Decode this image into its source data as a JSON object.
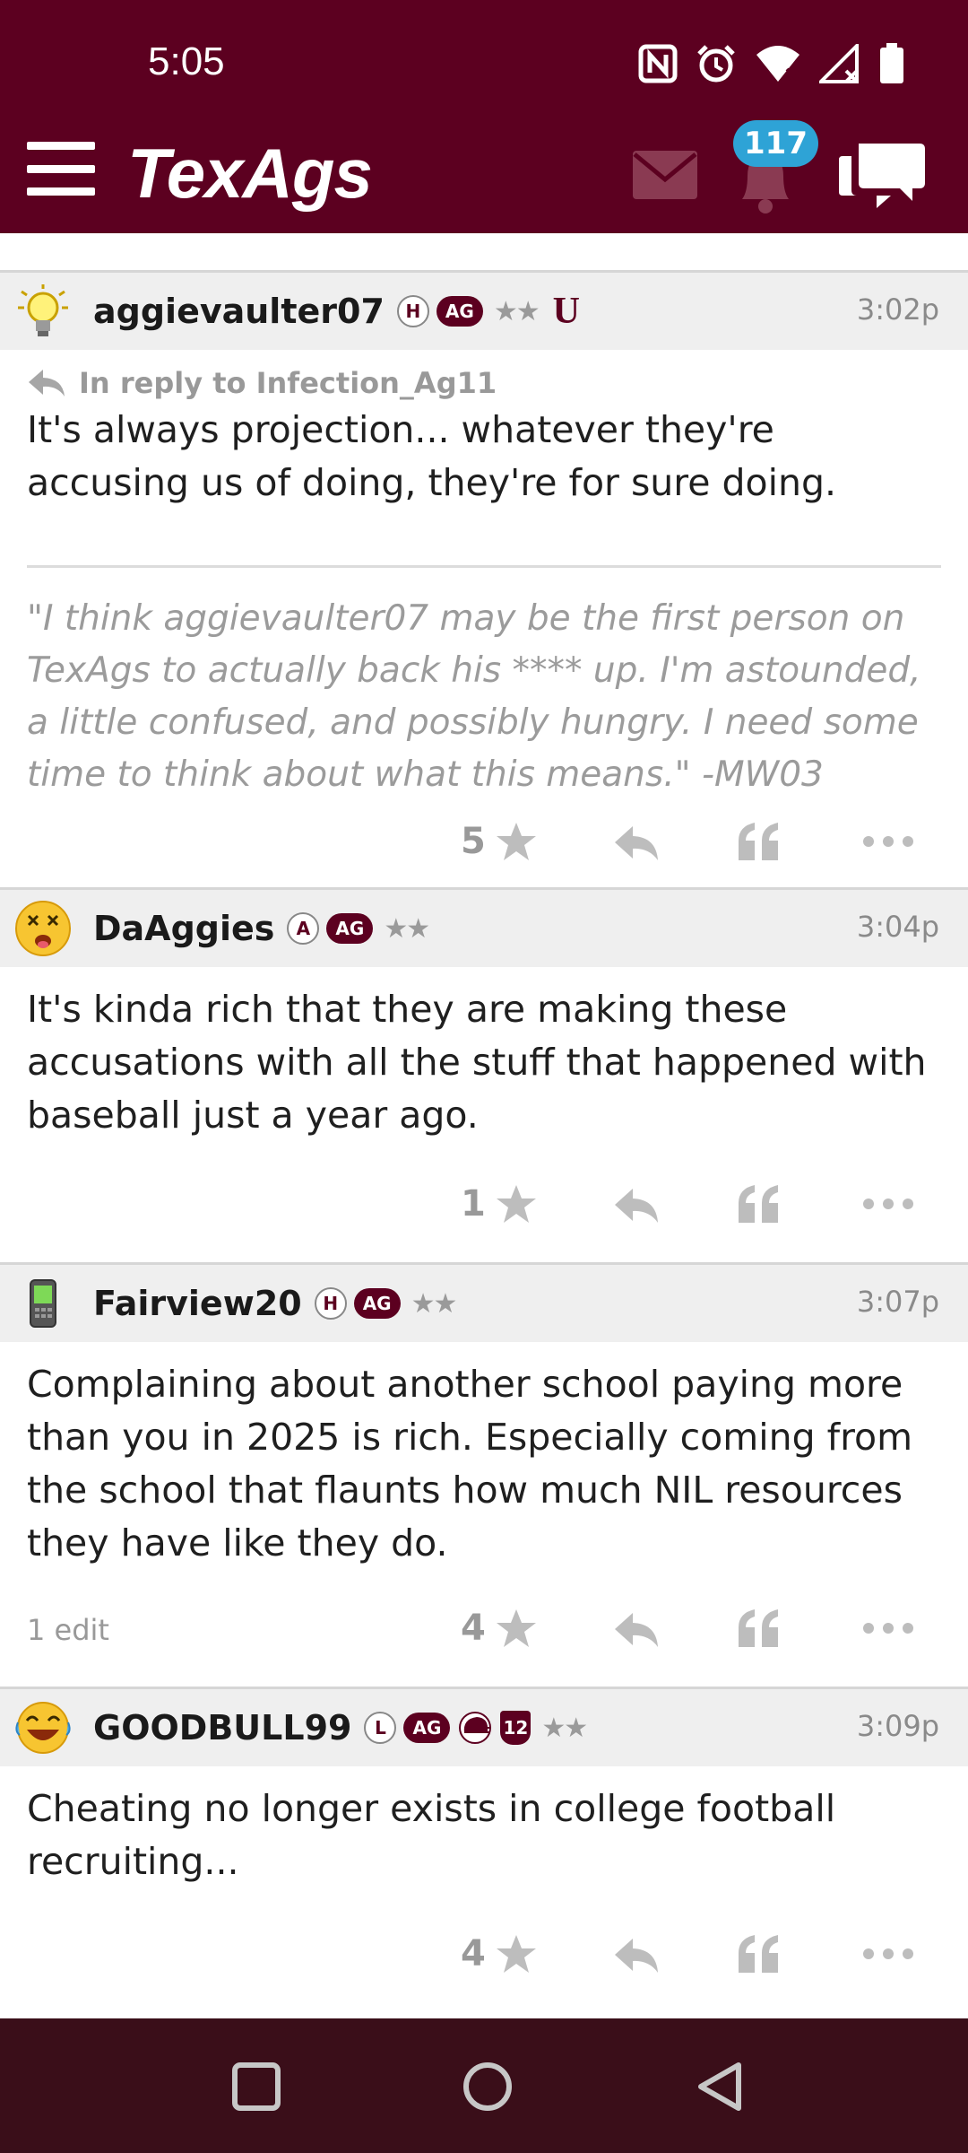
{
  "status_bar": {
    "time": "5:05"
  },
  "app": {
    "logo_text": "TexAgs",
    "notification_count": "117"
  },
  "colors": {
    "brand": "#5c0020",
    "badge": "#2ea3d6",
    "nav_bar": "#3a0e19"
  },
  "posts": [
    {
      "username": "aggievaulter07",
      "avatar_icon": "lightbulb-icon",
      "badges": {
        "letter": "H",
        "ag": "AG",
        "stars": "★★",
        "extra": "U"
      },
      "time": "3:02p",
      "reply_to": "In reply to Infection_Ag11",
      "text": "It's always projection... whatever they're accusing us of doing, they're for sure doing.",
      "signature": "\"I think aggievaulter07 may be the first person on TexAgs to actually back his **** up. I'm astounded, a little confused, and possibly hungry. I need some time to think about what this means.\" -MW03",
      "stars": "5"
    },
    {
      "username": "DaAggies",
      "avatar_icon": "dizzy-face-icon",
      "badges": {
        "letter": "A",
        "ag": "AG",
        "stars": "★★"
      },
      "time": "3:04p",
      "text": "It's kinda rich that they are making these accusations with all the stuff that happened with baseball just a year ago.",
      "stars": "1"
    },
    {
      "username": "Fairview20",
      "avatar_icon": "mobile-phone-icon",
      "badges": {
        "letter": "H",
        "ag": "AG",
        "stars": "★★"
      },
      "time": "3:07p",
      "text": "Complaining about another school paying more than you in 2025 is rich. Especially coming from the school that flaunts how much NIL resources they have like they do.",
      "edit_note": "1 edit",
      "stars": "4"
    },
    {
      "username": "GOODBULL99",
      "avatar_icon": "laughing-face-icon",
      "badges": {
        "letter": "L",
        "ag": "AG",
        "twelve": "12",
        "stars": "★★"
      },
      "time": "3:09p",
      "text": "Cheating no longer exists in college football recruiting...",
      "stars": "4"
    }
  ]
}
